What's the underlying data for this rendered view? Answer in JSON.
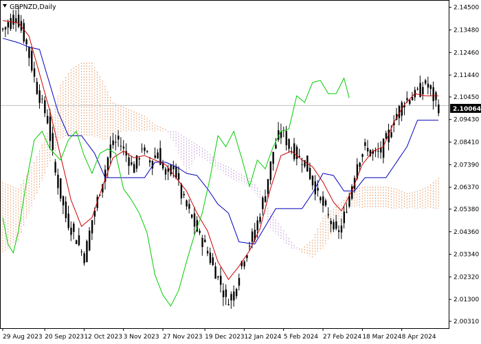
{
  "window": {
    "symbol_label": "GBPNZD,Daily",
    "current_price_label": "2.10064"
  },
  "colors": {
    "background": "#ffffff",
    "frame": "#000000",
    "candle": "#000000",
    "tenkan": "#cc0000",
    "kijun": "#0000bb",
    "chikou": "#00cc00",
    "kumo_bull": "#e8a070",
    "kumo_bear": "#c8a0d8",
    "current_line": "#c0c0c0"
  },
  "chart_data": {
    "type": "candlestick",
    "title": "GBPNZD,Daily",
    "ylim": [
      2.0,
      2.148
    ],
    "y_ticks": [
      "2.14500",
      "2.13480",
      "2.12460",
      "2.11440",
      "2.10450",
      "2.09430",
      "2.08410",
      "2.07390",
      "2.06370",
      "2.05380",
      "2.04360",
      "2.03340",
      "2.02320",
      "2.01300",
      "2.00310"
    ],
    "x_ticks": [
      "29 Aug 2023",
      "20 Sep 2023",
      "12 Oct 2023",
      "3 Nov 2023",
      "27 Nov 2023",
      "19 Dec 2023",
      "12 Jan 2024",
      "5 Feb 2024",
      "27 Feb 2024",
      "18 Mar 2024",
      "8 Apr 2024"
    ],
    "current_price": 2.10064,
    "indicators": [
      "Tenkan-sen",
      "Kijun-sen",
      "Chikou Span",
      "Senkou Span A/B cloud"
    ],
    "close_anchors": [
      [
        0,
        2.135
      ],
      [
        5,
        2.142
      ],
      [
        9,
        2.128
      ],
      [
        13,
        2.108
      ],
      [
        17,
        2.094
      ],
      [
        20,
        2.07
      ],
      [
        24,
        2.05
      ],
      [
        28,
        2.04
      ],
      [
        31,
        2.032
      ],
      [
        34,
        2.049
      ],
      [
        38,
        2.067
      ],
      [
        41,
        2.082
      ],
      [
        44,
        2.085
      ],
      [
        47,
        2.078
      ],
      [
        50,
        2.072
      ],
      [
        53,
        2.082
      ],
      [
        56,
        2.075
      ],
      [
        59,
        2.08
      ],
      [
        62,
        2.068
      ],
      [
        65,
        2.074
      ],
      [
        68,
        2.06
      ],
      [
        71,
        2.052
      ],
      [
        74,
        2.044
      ],
      [
        77,
        2.037
      ],
      [
        80,
        2.028
      ],
      [
        83,
        2.02
      ],
      [
        85,
        2.012
      ],
      [
        88,
        2.016
      ],
      [
        91,
        2.03
      ],
      [
        94,
        2.038
      ],
      [
        97,
        2.048
      ],
      [
        100,
        2.062
      ],
      [
        103,
        2.08
      ],
      [
        106,
        2.09
      ],
      [
        109,
        2.082
      ],
      [
        112,
        2.078
      ],
      [
        115,
        2.075
      ],
      [
        118,
        2.066
      ],
      [
        121,
        2.058
      ],
      [
        124,
        2.05
      ],
      [
        127,
        2.043
      ],
      [
        129,
        2.046
      ],
      [
        132,
        2.06
      ],
      [
        135,
        2.075
      ],
      [
        138,
        2.082
      ],
      [
        141,
        2.078
      ],
      [
        144,
        2.08
      ],
      [
        147,
        2.088
      ],
      [
        150,
        2.097
      ],
      [
        153,
        2.103
      ],
      [
        156,
        2.105
      ],
      [
        159,
        2.108
      ],
      [
        161,
        2.111
      ],
      [
        164,
        2.104
      ],
      [
        166,
        2.1
      ]
    ],
    "tenkan_anchors": [
      [
        0,
        2.139
      ],
      [
        6,
        2.138
      ],
      [
        10,
        2.132
      ],
      [
        14,
        2.115
      ],
      [
        18,
        2.098
      ],
      [
        22,
        2.078
      ],
      [
        26,
        2.058
      ],
      [
        30,
        2.046
      ],
      [
        34,
        2.05
      ],
      [
        38,
        2.064
      ],
      [
        42,
        2.077
      ],
      [
        46,
        2.08
      ],
      [
        50,
        2.077
      ],
      [
        54,
        2.078
      ],
      [
        58,
        2.076
      ],
      [
        62,
        2.074
      ],
      [
        66,
        2.068
      ],
      [
        70,
        2.062
      ],
      [
        74,
        2.052
      ],
      [
        78,
        2.044
      ],
      [
        82,
        2.03
      ],
      [
        86,
        2.022
      ],
      [
        90,
        2.028
      ],
      [
        94,
        2.035
      ],
      [
        98,
        2.045
      ],
      [
        102,
        2.063
      ],
      [
        106,
        2.078
      ],
      [
        110,
        2.08
      ],
      [
        114,
        2.076
      ],
      [
        118,
        2.073
      ],
      [
        122,
        2.066
      ],
      [
        126,
        2.057
      ],
      [
        129,
        2.053
      ],
      [
        133,
        2.062
      ],
      [
        137,
        2.074
      ],
      [
        141,
        2.08
      ],
      [
        145,
        2.082
      ],
      [
        149,
        2.093
      ],
      [
        153,
        2.101
      ],
      [
        157,
        2.106
      ],
      [
        161,
        2.105
      ],
      [
        166,
        2.105
      ]
    ],
    "kijun_anchors": [
      [
        0,
        2.131
      ],
      [
        6,
        2.129
      ],
      [
        10,
        2.127
      ],
      [
        14,
        2.126
      ],
      [
        17,
        2.114
      ],
      [
        21,
        2.098
      ],
      [
        25,
        2.087
      ],
      [
        30,
        2.087
      ],
      [
        35,
        2.079
      ],
      [
        39,
        2.068
      ],
      [
        44,
        2.068
      ],
      [
        50,
        2.068
      ],
      [
        54,
        2.068
      ],
      [
        58,
        2.075
      ],
      [
        62,
        2.075
      ],
      [
        66,
        2.073
      ],
      [
        70,
        2.07
      ],
      [
        74,
        2.069
      ],
      [
        78,
        2.063
      ],
      [
        82,
        2.056
      ],
      [
        86,
        2.052
      ],
      [
        90,
        2.039
      ],
      [
        96,
        2.038
      ],
      [
        100,
        2.046
      ],
      [
        104,
        2.054
      ],
      [
        110,
        2.054
      ],
      [
        114,
        2.054
      ],
      [
        118,
        2.061
      ],
      [
        122,
        2.07
      ],
      [
        126,
        2.069
      ],
      [
        130,
        2.062
      ],
      [
        134,
        2.062
      ],
      [
        138,
        2.068
      ],
      [
        142,
        2.068
      ],
      [
        146,
        2.068
      ],
      [
        150,
        2.075
      ],
      [
        154,
        2.082
      ],
      [
        158,
        2.094
      ],
      [
        162,
        2.094
      ],
      [
        166,
        2.094
      ]
    ],
    "chikou_anchors": [
      [
        0,
        2.05
      ],
      [
        2,
        2.038
      ],
      [
        4,
        2.034
      ],
      [
        6,
        2.044
      ],
      [
        9,
        2.066
      ],
      [
        12,
        2.085
      ],
      [
        15,
        2.089
      ],
      [
        18,
        2.081
      ],
      [
        22,
        2.076
      ],
      [
        25,
        2.085
      ],
      [
        28,
        2.089
      ],
      [
        31,
        2.078
      ],
      [
        34,
        2.07
      ],
      [
        37,
        2.079
      ],
      [
        40,
        2.081
      ],
      [
        43,
        2.079
      ],
      [
        46,
        2.063
      ],
      [
        49,
        2.058
      ],
      [
        52,
        2.052
      ],
      [
        55,
        2.043
      ],
      [
        58,
        2.024
      ],
      [
        61,
        2.015
      ],
      [
        64,
        2.01
      ],
      [
        67,
        2.017
      ],
      [
        70,
        2.03
      ],
      [
        73,
        2.042
      ],
      [
        76,
        2.052
      ],
      [
        79,
        2.068
      ],
      [
        82,
        2.087
      ],
      [
        85,
        2.082
      ],
      [
        88,
        2.089
      ],
      [
        91,
        2.077
      ],
      [
        94,
        2.064
      ],
      [
        97,
        2.076
      ],
      [
        100,
        2.072
      ],
      [
        103,
        2.082
      ],
      [
        106,
        2.089
      ],
      [
        109,
        2.09
      ],
      [
        112,
        2.105
      ],
      [
        115,
        2.102
      ],
      [
        118,
        2.111
      ],
      [
        121,
        2.112
      ],
      [
        124,
        2.106
      ],
      [
        127,
        2.106
      ],
      [
        130,
        2.113
      ],
      [
        132,
        2.104
      ]
    ],
    "span_a_anchors": [
      [
        0,
        2.066
      ],
      [
        6,
        2.063
      ],
      [
        12,
        2.075
      ],
      [
        18,
        2.091
      ],
      [
        22,
        2.11
      ],
      [
        26,
        2.117
      ],
      [
        30,
        2.12
      ],
      [
        34,
        2.12
      ],
      [
        38,
        2.112
      ],
      [
        42,
        2.102
      ],
      [
        46,
        2.1
      ],
      [
        50,
        2.098
      ],
      [
        54,
        2.096
      ],
      [
        58,
        2.092
      ],
      [
        62,
        2.09
      ],
      [
        66,
        2.082
      ],
      [
        70,
        2.07
      ],
      [
        74,
        2.078
      ],
      [
        78,
        2.075
      ],
      [
        82,
        2.072
      ],
      [
        86,
        2.068
      ],
      [
        90,
        2.066
      ],
      [
        94,
        2.064
      ],
      [
        98,
        2.058
      ],
      [
        102,
        2.045
      ],
      [
        106,
        2.04
      ],
      [
        110,
        2.036
      ],
      [
        114,
        2.036
      ],
      [
        118,
        2.04
      ],
      [
        122,
        2.05
      ],
      [
        126,
        2.054
      ],
      [
        130,
        2.058
      ],
      [
        134,
        2.063
      ],
      [
        138,
        2.064
      ],
      [
        142,
        2.064
      ],
      [
        146,
        2.064
      ],
      [
        150,
        2.063
      ],
      [
        154,
        2.061
      ],
      [
        158,
        2.062
      ],
      [
        162,
        2.064
      ],
      [
        166,
        2.068
      ]
    ],
    "span_b_anchors": [
      [
        0,
        2.034
      ],
      [
        6,
        2.04
      ],
      [
        12,
        2.058
      ],
      [
        18,
        2.075
      ],
      [
        22,
        2.085
      ],
      [
        26,
        2.087
      ],
      [
        30,
        2.087
      ],
      [
        34,
        2.087
      ],
      [
        38,
        2.085
      ],
      [
        42,
        2.086
      ],
      [
        46,
        2.089
      ],
      [
        50,
        2.089
      ],
      [
        54,
        2.089
      ],
      [
        58,
        2.089
      ],
      [
        62,
        2.089
      ],
      [
        66,
        2.089
      ],
      [
        70,
        2.086
      ],
      [
        74,
        2.083
      ],
      [
        78,
        2.08
      ],
      [
        82,
        2.075
      ],
      [
        86,
        2.073
      ],
      [
        90,
        2.07
      ],
      [
        94,
        2.068
      ],
      [
        98,
        2.062
      ],
      [
        102,
        2.052
      ],
      [
        106,
        2.046
      ],
      [
        110,
        2.039
      ],
      [
        114,
        2.034
      ],
      [
        118,
        2.032
      ],
      [
        122,
        2.036
      ],
      [
        126,
        2.044
      ],
      [
        130,
        2.052
      ],
      [
        134,
        2.055
      ],
      [
        138,
        2.054
      ],
      [
        142,
        2.054
      ],
      [
        146,
        2.054
      ],
      [
        150,
        2.054
      ],
      [
        154,
        2.054
      ],
      [
        158,
        2.054
      ],
      [
        162,
        2.054
      ],
      [
        166,
        2.054
      ]
    ]
  }
}
